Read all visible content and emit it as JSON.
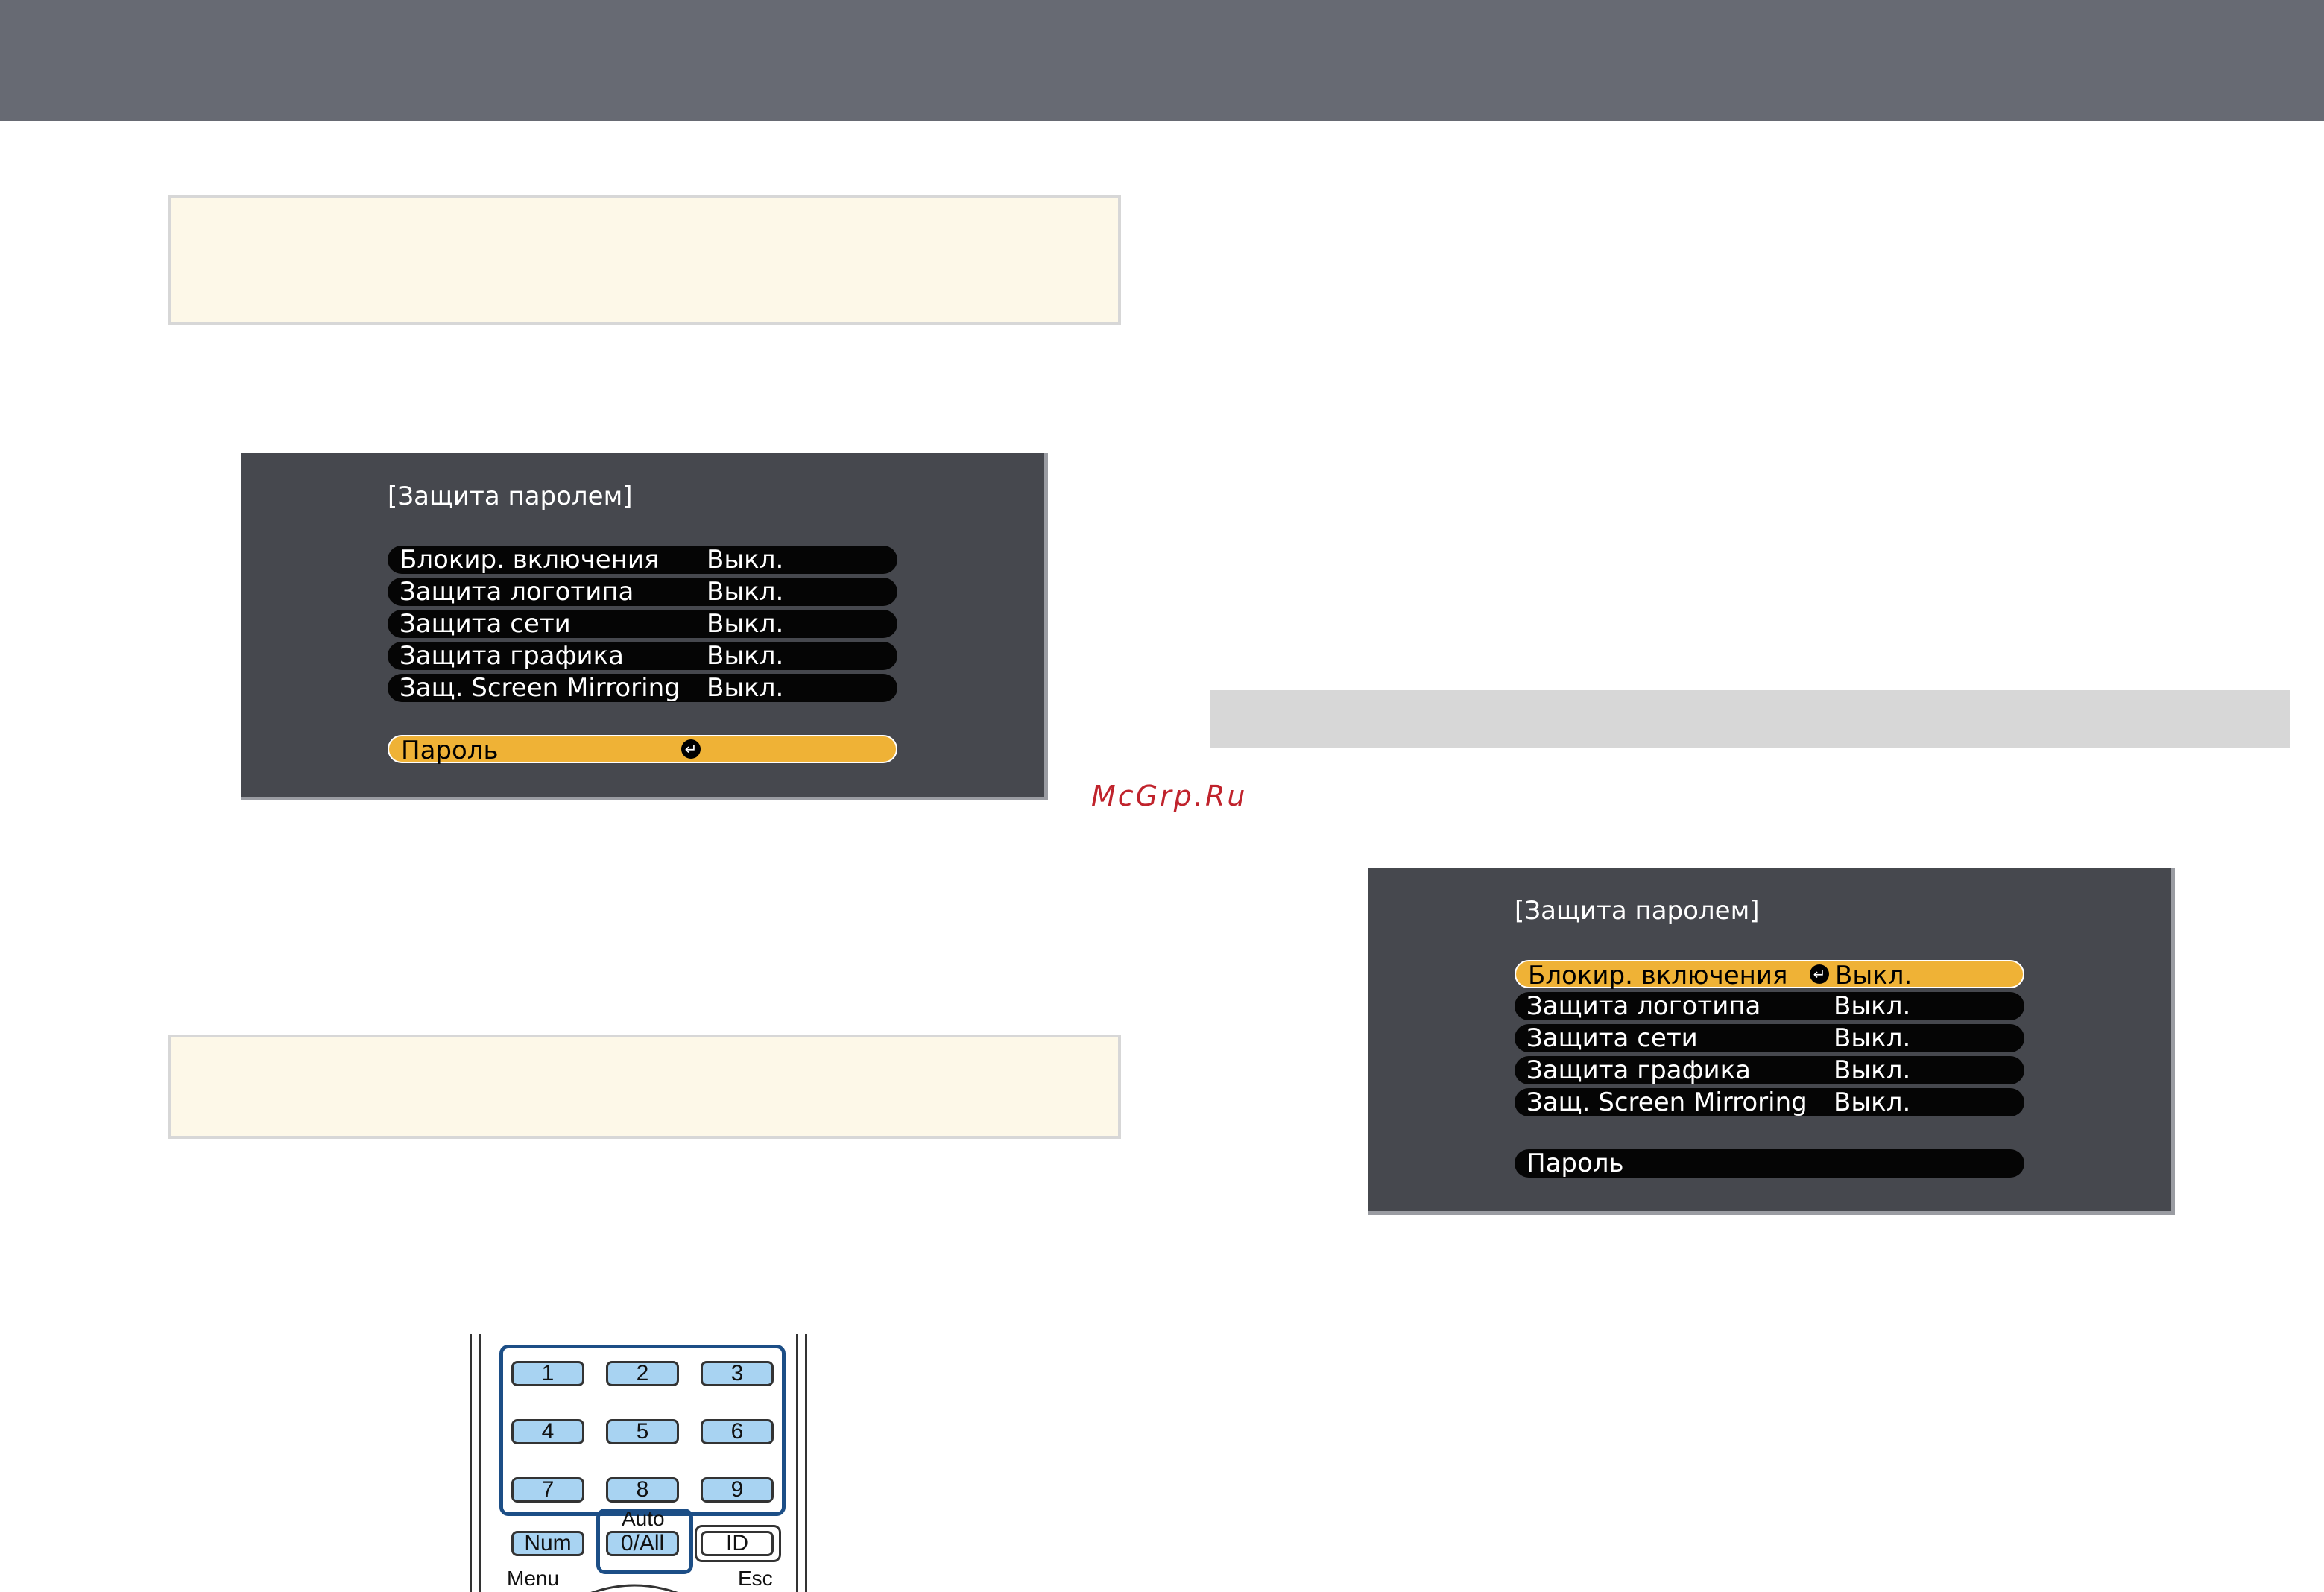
{
  "header": {},
  "watermark": "McGrp.Ru",
  "menu_left": {
    "title": "[Защита паролем]",
    "items": [
      {
        "label": "Блокир. включения",
        "value": "Выкл."
      },
      {
        "label": "Защита логотипа",
        "value": "Выкл."
      },
      {
        "label": "Защита сети",
        "value": "Выкл."
      },
      {
        "label": "Защита графика",
        "value": "Выкл."
      },
      {
        "label": "Защ. Screen Mirroring",
        "value": "Выкл."
      }
    ],
    "password": {
      "label": "Пароль",
      "icon": "enter-icon",
      "selected": true
    }
  },
  "menu_right": {
    "title": "[Защита паролем]",
    "items": [
      {
        "label": "Блокир. включения",
        "value": "Выкл.",
        "selected": true,
        "icon": "enter-icon"
      },
      {
        "label": "Защита логотипа",
        "value": "Выкл."
      },
      {
        "label": "Защита сети",
        "value": "Выкл."
      },
      {
        "label": "Защита графика",
        "value": "Выкл."
      },
      {
        "label": "Защ. Screen Mirroring",
        "value": "Выкл."
      }
    ],
    "password": {
      "label": "Пароль",
      "selected": false
    }
  },
  "remote": {
    "keys": [
      "1",
      "2",
      "3",
      "4",
      "5",
      "6",
      "7",
      "8",
      "9"
    ],
    "num_label": "Num",
    "auto_label": "Auto",
    "zero_label": "0/All",
    "id_label": "ID",
    "menu_label": "Menu",
    "esc_label": "Esc"
  },
  "colors": {
    "topbar": "#676a73",
    "note_bg": "#fdf8e8",
    "menu_highlight": "#efb236",
    "key_blue": "#a8d3f2",
    "outline_blue": "#1c4e86",
    "watermark": "#c0232c"
  }
}
